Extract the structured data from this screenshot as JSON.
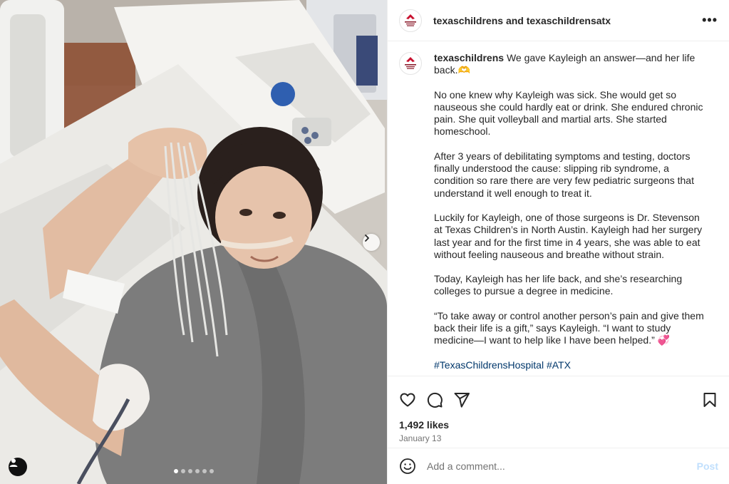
{
  "header": {
    "title": "texaschildrens and texaschildrensatx",
    "more_label": "•••"
  },
  "caption": {
    "username": "texaschildrens",
    "lead": "We gave Kayleigh an answer—and her life back.",
    "lead_emoji": "🫶",
    "paragraphs": [
      "No one knew why Kayleigh was sick. She would get so nauseous she could hardly eat or drink. She endured chronic pain. She quit volleyball and martial arts. She started homeschool.",
      "After 3 years of debilitating symptoms and testing, doctors finally understood the cause: slipping rib syndrome, a condition so rare there are very few pediatric surgeons that understand it well enough to treat it.",
      "Luckily for Kayleigh, one of those surgeons is Dr. Stevenson at Texas Children’s in North Austin. Kayleigh had her surgery last year and for the first time in 4 years, she was able to eat without feeling nauseous and breathe without strain.",
      "Today, Kayleigh has her life back, and she’s researching colleges to pursue a degree in medicine."
    ],
    "quote": "“To take away or control another person’s pain and give them back their life is a gift,” says Kayleigh. “I want to study medicine—I want to help like I have been helped.”",
    "quote_emoji": "💞",
    "hashtags": [
      "#TexasChildrensHospital",
      "#ATX"
    ]
  },
  "stats": {
    "likes": "1,492 likes",
    "date": "January 13"
  },
  "comment": {
    "placeholder": "Add a comment...",
    "post_label": "Post"
  },
  "carousel": {
    "total_slides": 6,
    "current_slide": 1
  },
  "icons": {
    "like": "heart-icon",
    "comment": "comment-bubble-icon",
    "share": "paper-plane-icon",
    "save": "bookmark-icon",
    "emoji": "smiley-icon",
    "next": "chevron-right-icon",
    "tag": "user-tag-icon",
    "more": "more-options-icon"
  },
  "colors": {
    "brand_red": "#c8102e",
    "hashtag": "#00376b",
    "post_disabled": "#c0dffd"
  }
}
